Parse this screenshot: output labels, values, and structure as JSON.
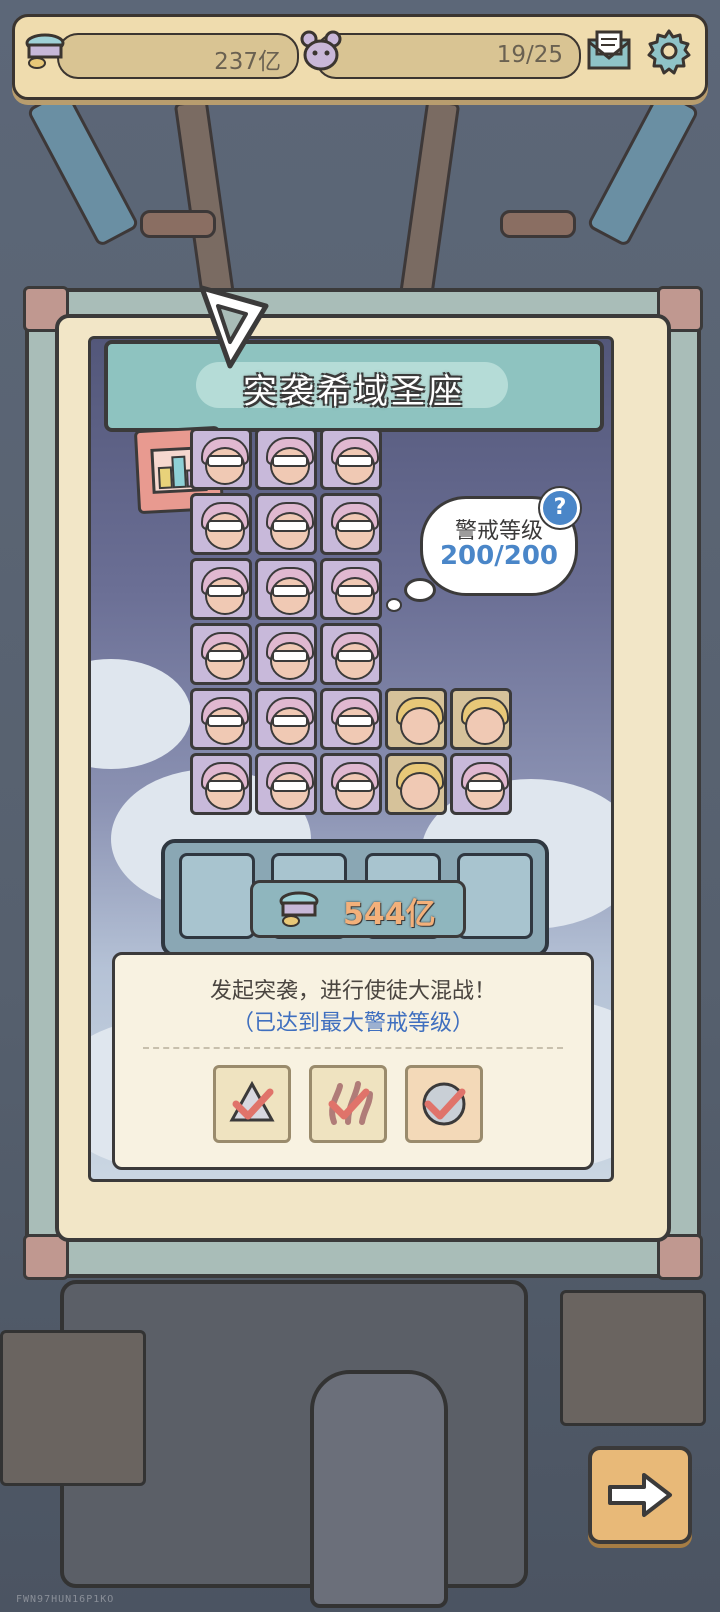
{
  "topbar": {
    "coins": "237亿",
    "level_progress": "19/25",
    "icons": [
      "coin-stack-icon",
      "creature-icon",
      "mail-icon",
      "gear-icon"
    ]
  },
  "raid": {
    "title": "突袭希域圣座",
    "alert_label": "警戒等级",
    "alert_value": "200/200",
    "help_symbol": "?",
    "cost": "544亿",
    "description": "发起突袭，进行使徒大混战！",
    "status": "（已达到最大警戒等级）",
    "checks": [
      "crystal-check-icon",
      "coral-check-icon",
      "orb-check-icon"
    ]
  },
  "grid": {
    "rows": [
      [
        "purple",
        "purple",
        "purple"
      ],
      [
        "purple",
        "purple",
        "purple"
      ],
      [
        "purple",
        "purple",
        "purple"
      ],
      [
        "purple",
        "purple",
        "purple"
      ],
      [
        "purple",
        "purple",
        "purple",
        "gold",
        "gold"
      ],
      [
        "purple",
        "purple",
        "purple",
        "gold",
        "purple"
      ]
    ]
  },
  "footer": {
    "watermark": "FWN97HUN16P1KO"
  },
  "colors": {
    "accent_blue": "#4a86c8",
    "banner_teal": "#8ec3c0",
    "cost_orange": "#f3b07a"
  }
}
